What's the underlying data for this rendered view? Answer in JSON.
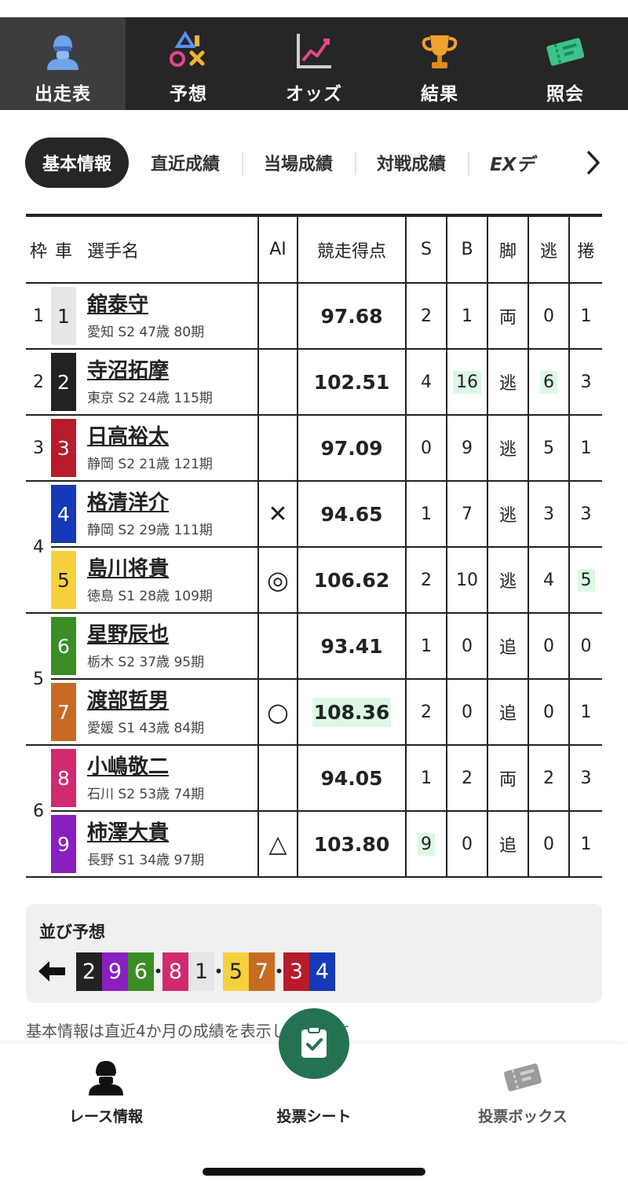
{
  "top_nav": {
    "tabs": [
      {
        "label": "出走表",
        "icon": "rider-helmet-icon",
        "active": true
      },
      {
        "label": "予想",
        "icon": "prediction-symbols-icon",
        "active": false
      },
      {
        "label": "オッズ",
        "icon": "trend-chart-icon",
        "active": false
      },
      {
        "label": "結果",
        "icon": "trophy-icon",
        "active": false
      },
      {
        "label": "照会",
        "icon": "ticket-icon",
        "active": false
      }
    ]
  },
  "sub_tabs": [
    {
      "label": "基本情報",
      "active": true
    },
    {
      "label": "直近成績",
      "active": false
    },
    {
      "label": "当場成績",
      "active": false
    },
    {
      "label": "対戦成績",
      "active": false
    },
    {
      "label": "EXデ",
      "active": false
    }
  ],
  "table": {
    "headers": {
      "frame": "枠",
      "car": "車",
      "name": "選手名",
      "ai": "AI",
      "score": "競走得点",
      "s": "S",
      "b": "B",
      "leg": "脚",
      "nige": "逃",
      "makuri": "捲"
    },
    "frames": [
      "1",
      "2",
      "3",
      "4",
      "5",
      "6"
    ],
    "rows": [
      {
        "car": "1",
        "name": "舘泰守",
        "info": "愛知 S2 47歳 80期",
        "ai": "",
        "score": "97.68",
        "s": "2",
        "b": "1",
        "leg": "両",
        "nige": "0",
        "makuri": "1"
      },
      {
        "car": "2",
        "name": "寺沼拓摩",
        "info": "東京 S2 24歳 115期",
        "ai": "",
        "score": "102.51",
        "s": "4",
        "b": "16",
        "leg": "逃",
        "nige": "6",
        "makuri": "3"
      },
      {
        "car": "3",
        "name": "日高裕太",
        "info": "静岡 S2 21歳 121期",
        "ai": "",
        "score": "97.09",
        "s": "0",
        "b": "9",
        "leg": "逃",
        "nige": "5",
        "makuri": "1"
      },
      {
        "car": "4",
        "name": "格清洋介",
        "info": "静岡 S2 29歳 111期",
        "ai": "✕",
        "score": "94.65",
        "s": "1",
        "b": "7",
        "leg": "逃",
        "nige": "3",
        "makuri": "3"
      },
      {
        "car": "5",
        "name": "島川将貴",
        "info": "徳島 S1 28歳 109期",
        "ai": "◎",
        "score": "106.62",
        "s": "2",
        "b": "10",
        "leg": "逃",
        "nige": "4",
        "makuri": "5"
      },
      {
        "car": "6",
        "name": "星野辰也",
        "info": "栃木 S2 37歳 95期",
        "ai": "",
        "score": "93.41",
        "s": "1",
        "b": "0",
        "leg": "追",
        "nige": "0",
        "makuri": "0"
      },
      {
        "car": "7",
        "name": "渡部哲男",
        "info": "愛媛 S1 43歳 84期",
        "ai": "○",
        "score": "108.36",
        "s": "2",
        "b": "0",
        "leg": "追",
        "nige": "0",
        "makuri": "1"
      },
      {
        "car": "8",
        "name": "小嶋敬二",
        "info": "石川 S2 53歳 74期",
        "ai": "",
        "score": "94.05",
        "s": "1",
        "b": "2",
        "leg": "両",
        "nige": "2",
        "makuri": "3"
      },
      {
        "car": "9",
        "name": "柿澤大貴",
        "info": "長野 S1 34歳 97期",
        "ai": "△",
        "score": "103.80",
        "s": "9",
        "b": "0",
        "leg": "追",
        "nige": "0",
        "makuri": "1"
      }
    ]
  },
  "line_prediction": {
    "title": "並び予想",
    "groups": [
      [
        "2",
        "9",
        "6"
      ],
      [
        "8",
        "1"
      ],
      [
        "5",
        "7"
      ],
      [
        "3",
        "4"
      ]
    ]
  },
  "colors": {
    "car_1": "#e6e6e6",
    "car_2": "#222222",
    "car_3": "#b71c2c",
    "car_4": "#1639b8",
    "car_5": "#f7d13d",
    "car_6": "#3b8d26",
    "car_7": "#c86a24",
    "car_8": "#d12a6e",
    "car_9": "#8a1fc1",
    "highlight": "#dcf8e4",
    "accent_green": "#257252"
  },
  "footnote": "基本情報は直近4か月の成績を表示しています",
  "bottom_nav": {
    "race_info": "レース情報",
    "bet_sheet": "投票シート",
    "bet_box": "投票ボックス"
  }
}
